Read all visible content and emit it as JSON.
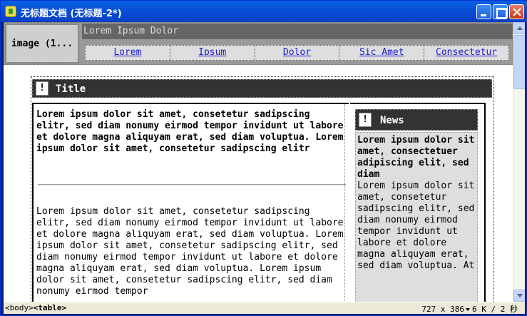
{
  "window": {
    "title": "无标题文档 (无标题-2*)"
  },
  "header": {
    "image_placeholder": "image (1...",
    "site_name": "Lorem Ipsum Dolor",
    "nav": [
      "Lorem",
      "Ipsum",
      "Dolor",
      "Sic Amet",
      "Consectetur"
    ]
  },
  "content": {
    "title_bang": "!",
    "title": "Title",
    "lead": "Lorem ipsum dolor sit amet, consetetur sadipscing elitr, sed diam nonumy eirmod tempor invidunt ut labore et dolore magna aliquyam erat, sed diam voluptua. Lorem ipsum dolor sit amet, consetetur sadipscing elitr",
    "body": "Lorem ipsum dolor sit amet, consetetur sadipscing elitr, sed diam nonumy eirmod tempor invidunt ut labore et dolore magna aliquyam erat, sed diam voluptua. Lorem ipsum dolor sit amet, consetetur sadipscing elitr, sed diam nonumy eirmod tempor invidunt ut labore et dolore magna aliquyam erat, sed diam voluptua. Lorem ipsum dolor sit amet, consetetur sadipscing elitr, sed diam nonumy eirmod tempor"
  },
  "news": {
    "bang": "!",
    "title": "News",
    "lead": "Lorem ipsum dolor sit amet, consectetuer adipiscing elit, sed diam",
    "body": "Lorem ipsum dolor sit amet, consetetur sadipscing elitr, sed diam nonumy eirmod tempor invidunt ut labore et dolore magna aliquyam erat, sed diam voluptua. At"
  },
  "statusbar": {
    "tag_body": "<body>",
    "tag_table": "<table>",
    "dimensions": "727 x 386",
    "size": "6 K / 2 秒"
  }
}
